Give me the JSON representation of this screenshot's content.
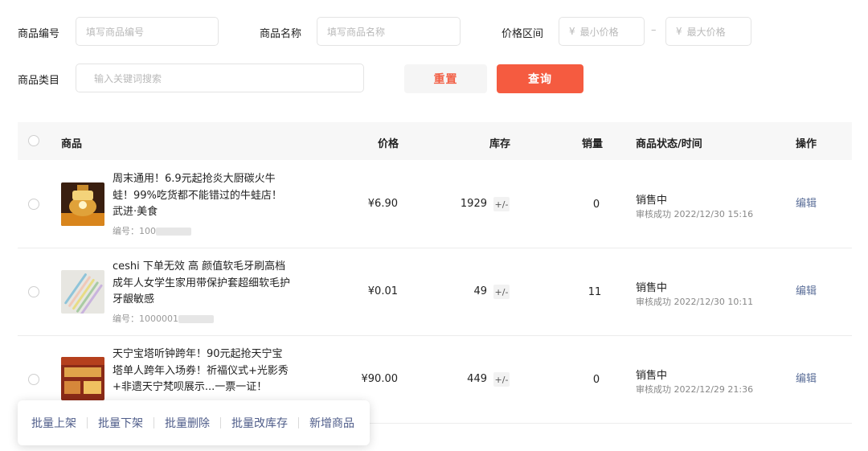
{
  "filters": {
    "product_code_label": "商品编号",
    "product_code_placeholder": "填写商品编号",
    "product_name_label": "商品名称",
    "product_name_placeholder": "填写商品名称",
    "price_range_label": "价格区间",
    "currency_symbol": "¥",
    "min_price_placeholder": "最小价格",
    "range_separator": "–",
    "max_price_placeholder": "最大价格",
    "category_label": "商品类目",
    "category_placeholder": "输入关键词搜索",
    "reset_label": "重置",
    "query_label": "查询"
  },
  "table": {
    "headers": {
      "product": "商品",
      "price": "价格",
      "stock": "库存",
      "sales": "销量",
      "status_time": "商品状态/时间",
      "actions": "操作"
    },
    "rows": [
      {
        "title": "周末通用！6.9元起抢炎大厨碳火牛蛙！99%吃货都不能错过的牛蛙店！武进·美食",
        "code_prefix": "编号：100",
        "price": "¥6.90",
        "stock": "1929",
        "stock_edit": "+/-",
        "sales": "0",
        "status": "销售中",
        "audit": "审核成功 2022/12/30 15:16",
        "edit": "编辑"
      },
      {
        "title": "ceshi 下单无效 高 颜值软毛牙刷高档成年人女学生家用带保护套超细软毛护牙龈敏感",
        "code_prefix": "编号：1000001",
        "price": "¥0.01",
        "stock": "49",
        "stock_edit": "+/-",
        "sales": "11",
        "status": "销售中",
        "audit": "审核成功 2022/12/30 10:11",
        "edit": "编辑"
      },
      {
        "title": "天宁宝塔听钟跨年！90元起抢天宁宝塔单人跨年入场券！祈福仪式+光影秀+非遗天宁梵呗展示...一票一证！",
        "code_prefix": "",
        "price": "¥90.00",
        "stock": "449",
        "stock_edit": "+/-",
        "sales": "0",
        "status": "销售中",
        "audit": "审核成功 2022/12/29 21:36",
        "edit": "编辑"
      }
    ]
  },
  "batch_actions": {
    "list": "批量上架",
    "delist": "批量下架",
    "delete": "批量删除",
    "edit_stock": "批量改库存",
    "add": "新增商品"
  },
  "colors": {
    "accent": "#f55b40",
    "link": "#5c6f99"
  },
  "icons": [
    "radio-icon",
    "stock-edit-icon"
  ]
}
